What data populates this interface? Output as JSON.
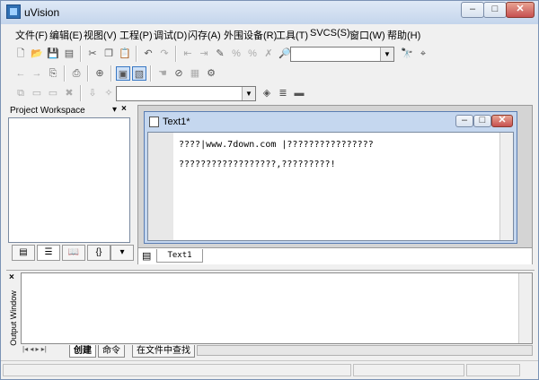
{
  "window": {
    "title": "uVision",
    "minimize": "‒",
    "maximize": "□",
    "close": "✕"
  },
  "menu": [
    "文件(F)",
    "编辑(E)",
    "视图(V)",
    "工程(P)",
    "调试(D)",
    "闪存(A)",
    "外围设备(R)",
    "工具(T)",
    "SVCS(S)",
    "窗口(W)",
    "帮助(H)"
  ],
  "toolbar1": {
    "combo_value": ""
  },
  "toolbar3": {
    "combo_value": ""
  },
  "project_workspace": {
    "title": "Project Workspace",
    "pin": "▾",
    "close": "×"
  },
  "document": {
    "title": "Text1*",
    "lines": [
      "????|www.7down.com |????????????????",
      "??????????????????,?????????!"
    ],
    "tab": "Text1"
  },
  "output": {
    "label": "Output Window",
    "close": "×",
    "tabs": [
      "创建",
      "命令",
      "在文件中查找"
    ]
  },
  "icons": {
    "new": "new-file-icon",
    "open": "open-folder-icon",
    "save": "save-icon",
    "save_all": "save-all-icon",
    "cut": "cut-icon",
    "copy": "copy-icon",
    "paste": "paste-icon",
    "undo": "undo-icon",
    "redo": "redo-icon",
    "find": "binoculars-icon"
  },
  "colors": {
    "title_gradient_top": "#dfe9f6",
    "accent": "#3978c4"
  }
}
